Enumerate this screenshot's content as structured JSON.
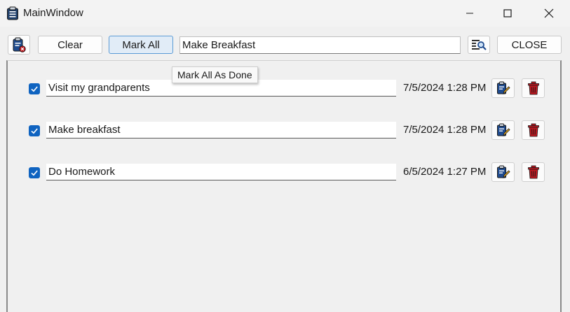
{
  "window": {
    "title": "MainWindow",
    "app_icon": "clipboard-icon"
  },
  "toolbar": {
    "clear_tasks_icon": "clipboard-delete-icon",
    "clear_label": "Clear",
    "mark_all_label": "Mark All",
    "search_value": "Make Breakfast",
    "search_icon": "list-search-icon",
    "close_label": "CLOSE"
  },
  "tooltip": {
    "text": "Mark All As Done"
  },
  "tasks": [
    {
      "text": "Visit my grandparents",
      "date": "7/5/2024 1:28 PM",
      "done": true
    },
    {
      "text": "Make breakfast",
      "date": "7/5/2024 1:28 PM",
      "done": true
    },
    {
      "text": "Do Homework",
      "date": "6/5/2024 1:27 PM",
      "done": true
    }
  ],
  "colors": {
    "accent": "#0f63c0",
    "delete": "#c0171f",
    "pencil": "#f2b01e"
  }
}
